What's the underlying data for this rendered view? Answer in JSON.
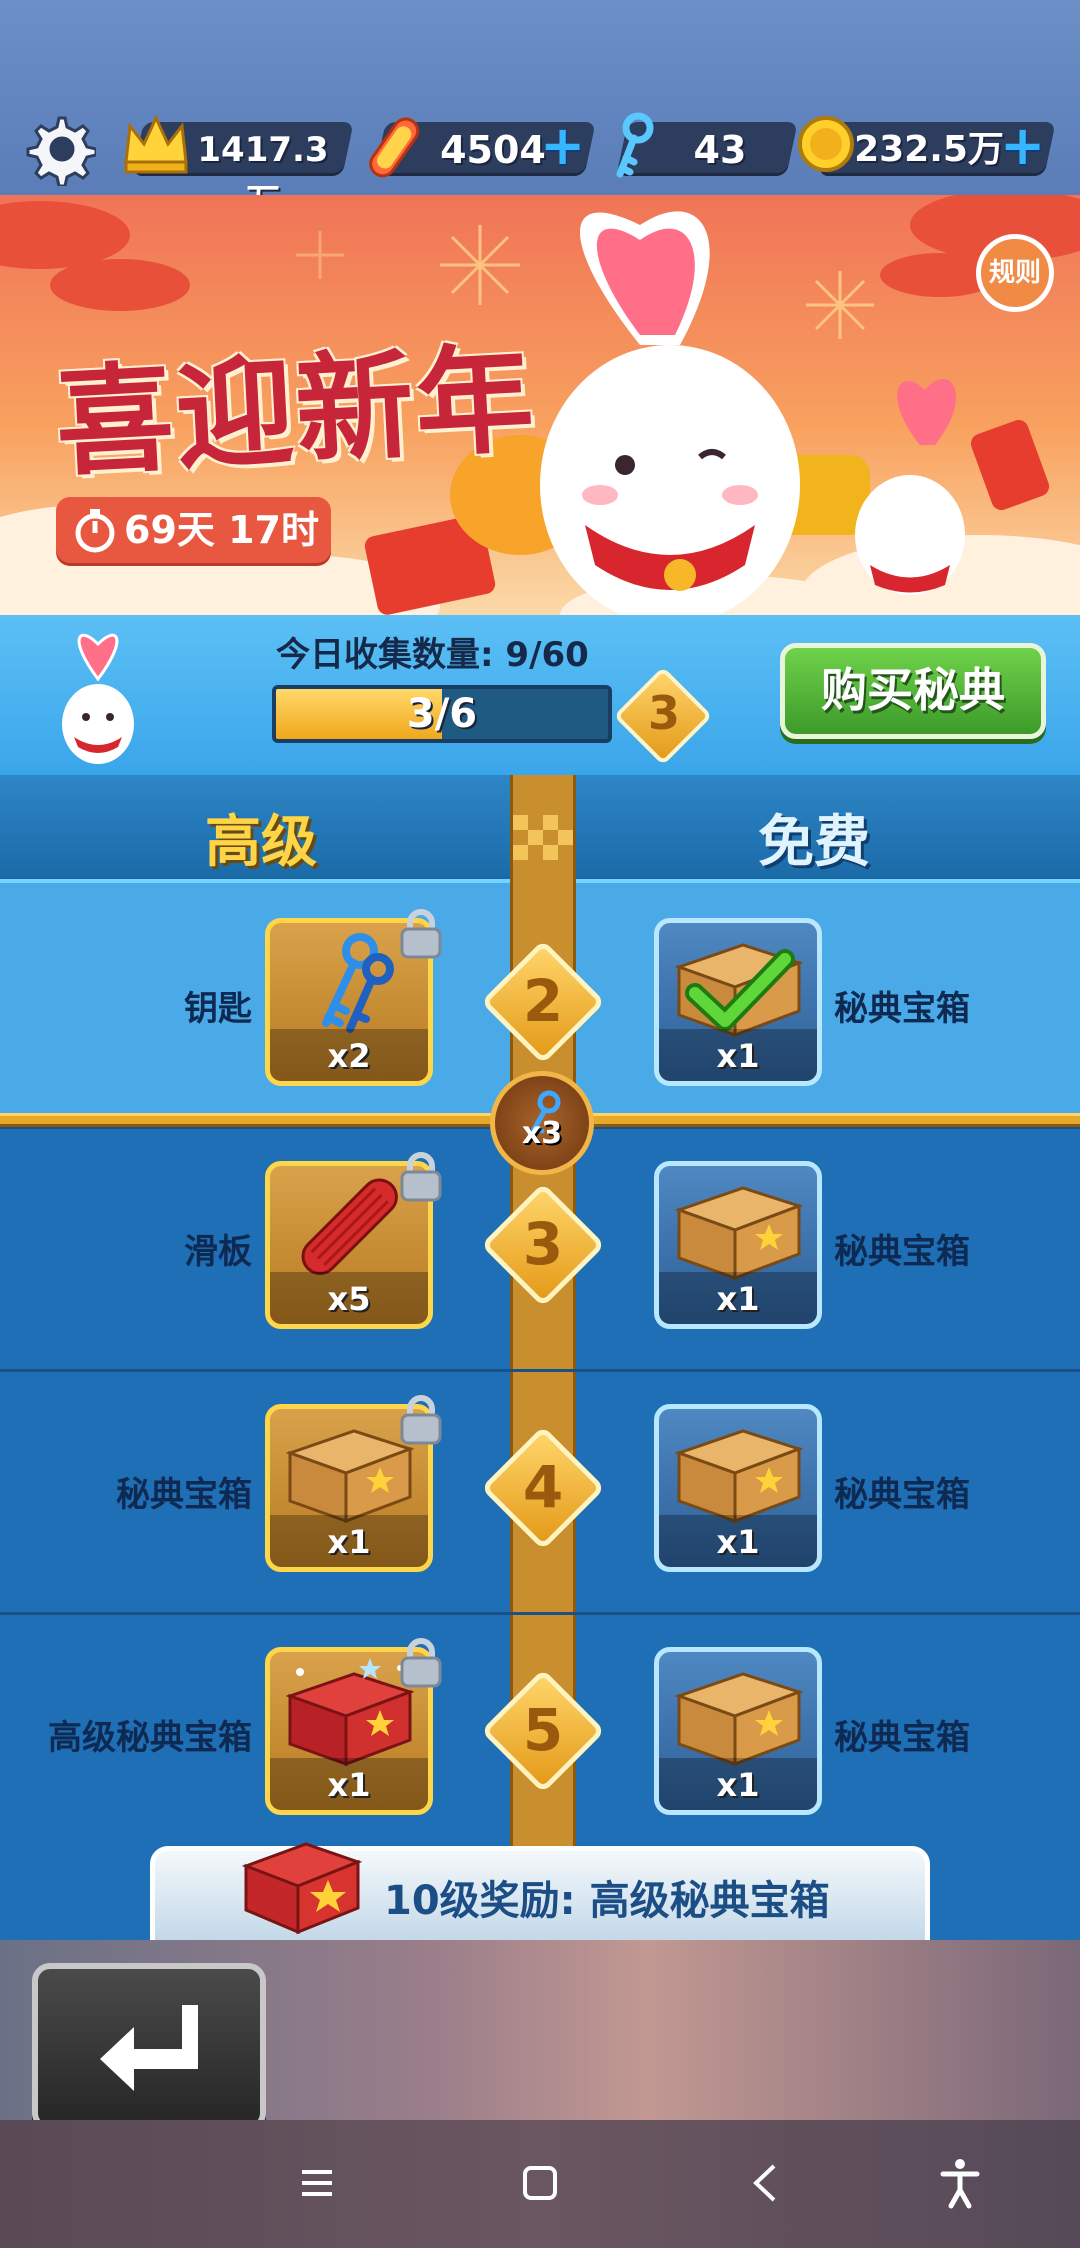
{
  "resources": {
    "crowns": "1417.3万",
    "boards": "4504",
    "keys": "43",
    "coins": "232.5万",
    "plus": "+"
  },
  "banner": {
    "title": "喜迎新年",
    "timer": "69天 17时",
    "rules": "规则"
  },
  "progress": {
    "collect_label": "今日收集数量: 9/60",
    "bar_text": "3/6",
    "bar_fraction": 0.5,
    "level": "3",
    "buy_button": "购买秘典"
  },
  "columns": {
    "premium": "高级",
    "free": "免费"
  },
  "marker": {
    "qty": "x3"
  },
  "rows": [
    {
      "step": "2",
      "premium_label": "钥匙",
      "premium_qty": "x2",
      "premium_icon": "keys-icon",
      "free_label": "秘典宝箱",
      "free_qty": "x1",
      "free_icon": "crate-claimed-icon"
    },
    {
      "step": "3",
      "premium_label": "滑板",
      "premium_qty": "x5",
      "premium_icon": "skateboard-icon",
      "free_label": "秘典宝箱",
      "free_qty": "x1",
      "free_icon": "crate-icon"
    },
    {
      "step": "4",
      "premium_label": "秘典宝箱",
      "premium_qty": "x1",
      "premium_icon": "crate-icon",
      "free_label": "秘典宝箱",
      "free_qty": "x1",
      "free_icon": "crate-icon"
    },
    {
      "step": "5",
      "premium_label": "高级秘典宝箱",
      "premium_qty": "x1",
      "premium_icon": "red-chest-icon",
      "free_label": "秘典宝箱",
      "free_qty": "x1",
      "free_icon": "crate-icon"
    }
  ],
  "footer": {
    "reward": "10级奖励: 高级秘典宝箱"
  },
  "menu": {
    "label": "菜单"
  },
  "colors": {
    "premium_col": "#4aa8e8",
    "free_col": "#4aa8e8",
    "track": "#c98f2e",
    "buy_green": "#4aa82e"
  }
}
